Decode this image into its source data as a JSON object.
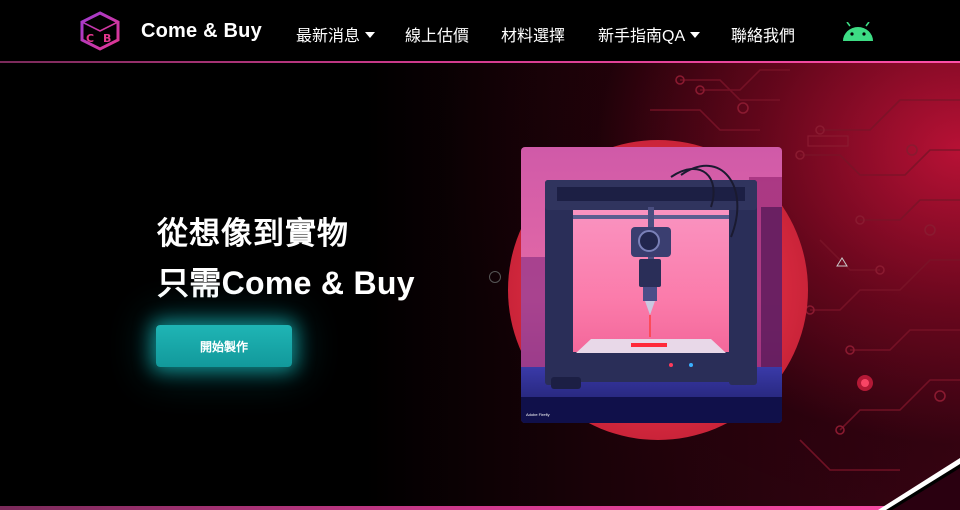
{
  "brand": {
    "name": "Come & Buy",
    "logo_text": "CB",
    "logo_icon": "cube-logo-icon"
  },
  "nav": {
    "items": [
      {
        "label": "最新消息",
        "has_dropdown": true
      },
      {
        "label": "線上估價",
        "has_dropdown": false
      },
      {
        "label": "材料選擇",
        "has_dropdown": false
      },
      {
        "label": "新手指南QA",
        "has_dropdown": true
      },
      {
        "label": "聯絡我們",
        "has_dropdown": false
      }
    ],
    "app_icon": "android-icon"
  },
  "hero": {
    "headline_line1": "從想像到實物",
    "headline_line2": "只需Come & Buy",
    "cta_label": "開始製作",
    "image_caption": "Adobe Firefly",
    "image_alt": "3D printer"
  },
  "colors": {
    "accent_teal": "#12999b",
    "brand_pink": "#d13a8e",
    "hero_red": "#d82a40",
    "android_green": "#3ddc84"
  }
}
